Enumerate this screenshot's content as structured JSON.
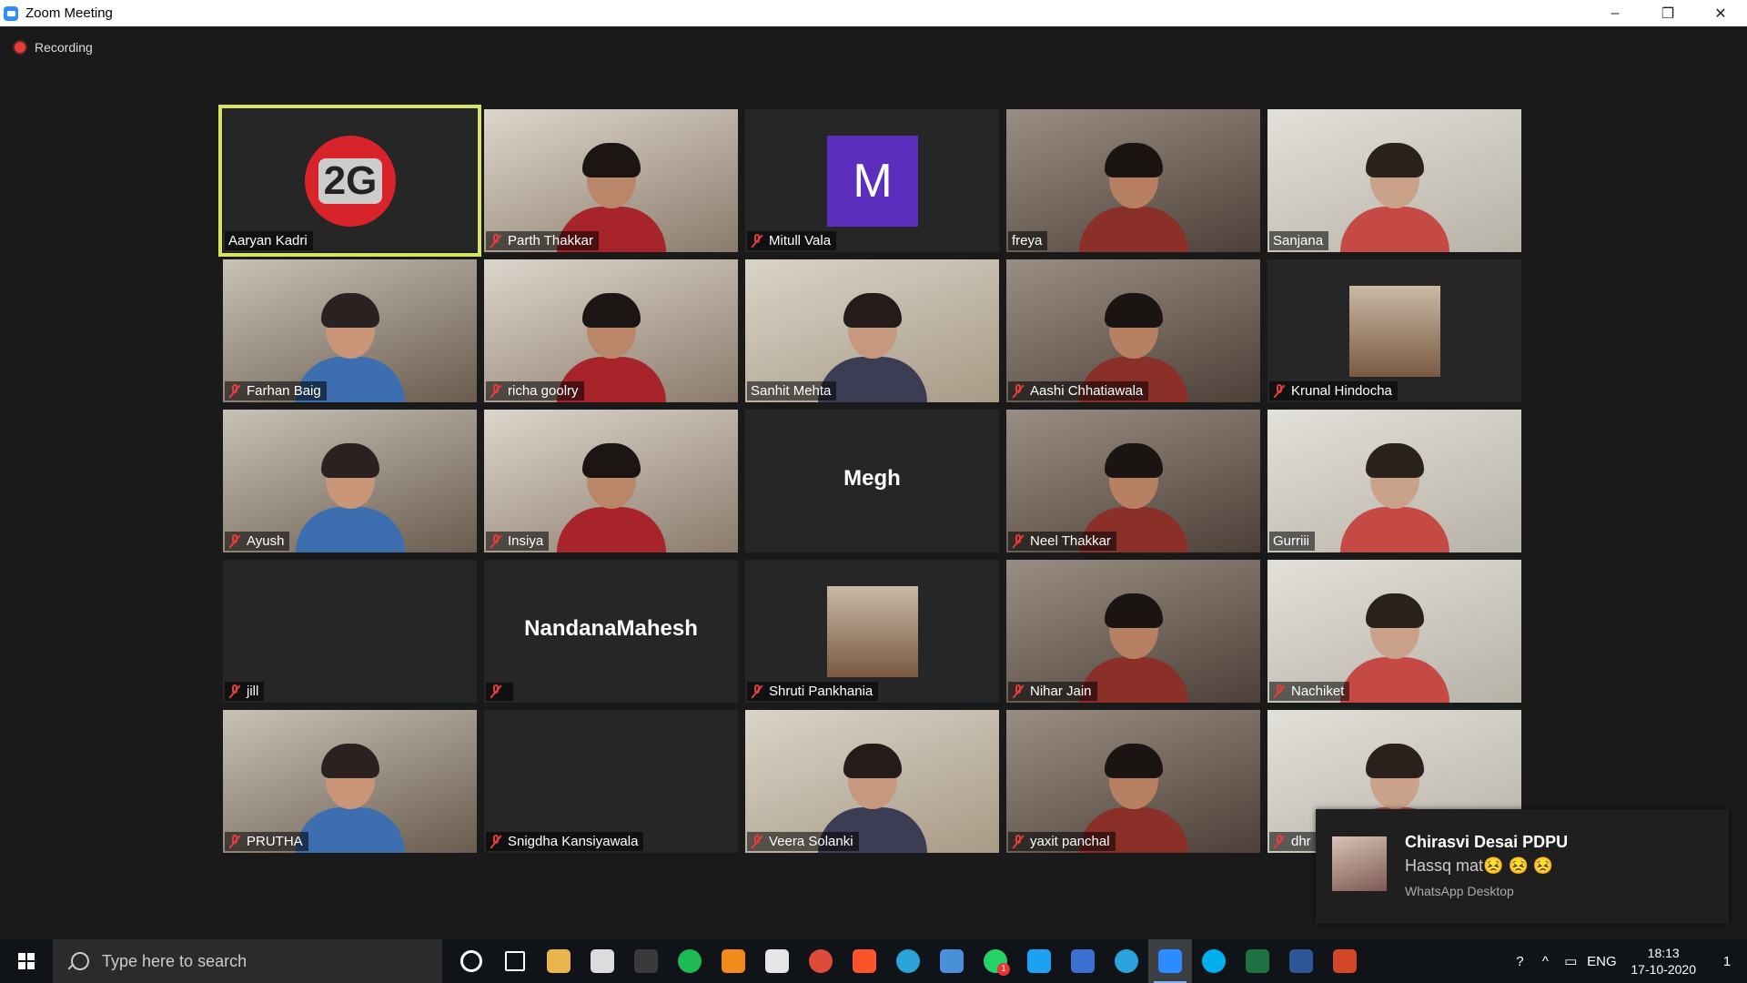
{
  "window": {
    "title": "Zoom Meeting",
    "controls": {
      "minimize": "–",
      "restore": "❐",
      "close": "✕"
    }
  },
  "recording": {
    "label": "Recording"
  },
  "participants": [
    {
      "name": "Aaryan Kadri",
      "muted": false,
      "kind": "logo",
      "logo_text": "2G",
      "active": true
    },
    {
      "name": "Parth Thakkar",
      "muted": true,
      "kind": "video"
    },
    {
      "name": "Mitull Vala",
      "muted": true,
      "kind": "initial",
      "initial": "M"
    },
    {
      "name": "freya",
      "muted": false,
      "kind": "video"
    },
    {
      "name": "Sanjana",
      "muted": false,
      "kind": "video"
    },
    {
      "name": "Farhan Baig",
      "muted": true,
      "kind": "video"
    },
    {
      "name": "richa goolry",
      "muted": true,
      "kind": "video"
    },
    {
      "name": "Sanhit Mehta",
      "muted": false,
      "kind": "video"
    },
    {
      "name": "Aashi Chhatiawala",
      "muted": true,
      "kind": "video"
    },
    {
      "name": "Krunal Hindocha",
      "muted": true,
      "kind": "photo"
    },
    {
      "name": "Ayush",
      "muted": true,
      "kind": "video"
    },
    {
      "name": "Insiya",
      "muted": true,
      "kind": "video"
    },
    {
      "name": "Megh",
      "muted": false,
      "kind": "bigname",
      "show_plate": false
    },
    {
      "name": "Neel Thakkar",
      "muted": true,
      "kind": "video"
    },
    {
      "name": "Gurriii",
      "muted": false,
      "kind": "video"
    },
    {
      "name": "jill",
      "muted": true,
      "kind": "blank"
    },
    {
      "name": "NandanaMahesh",
      "muted": true,
      "kind": "bigname",
      "plate_text": ""
    },
    {
      "name": "Shruti Pankhania",
      "muted": true,
      "kind": "photo"
    },
    {
      "name": "Nihar Jain",
      "muted": true,
      "kind": "video"
    },
    {
      "name": "Nachiket",
      "muted": true,
      "kind": "video"
    },
    {
      "name": "PRUTHA",
      "muted": true,
      "kind": "video"
    },
    {
      "name": "Snigdha Kansiyawala",
      "muted": true,
      "kind": "blank"
    },
    {
      "name": "Veera Solanki",
      "muted": true,
      "kind": "video"
    },
    {
      "name": "yaxit panchal",
      "muted": true,
      "kind": "video"
    },
    {
      "name": "dhr",
      "muted": true,
      "kind": "video"
    }
  ],
  "notification": {
    "sender": "Chirasvi Desai PDPU",
    "message": "Hassq mat😣 😣 😣",
    "app": "WhatsApp Desktop"
  },
  "taskbar": {
    "search_placeholder": "Type here to search",
    "apps": [
      {
        "name": "cortana",
        "color": "#101418"
      },
      {
        "name": "task-view",
        "color": "#101418"
      },
      {
        "name": "file-explorer",
        "color": "#e8b64a"
      },
      {
        "name": "store",
        "color": "#dcdcdc"
      },
      {
        "name": "app-dark",
        "color": "#3a3a3a"
      },
      {
        "name": "spotify",
        "color": "#1db954"
      },
      {
        "name": "vlc",
        "color": "#f28a1e"
      },
      {
        "name": "defender",
        "color": "#e6e6e6"
      },
      {
        "name": "chrome",
        "color": "#dd4b39"
      },
      {
        "name": "brave",
        "color": "#fb542b"
      },
      {
        "name": "edge",
        "color": "#2ba3d8"
      },
      {
        "name": "mail",
        "color": "#4a90d9"
      },
      {
        "name": "whatsapp",
        "color": "#25d366",
        "badge": "1"
      },
      {
        "name": "twitter",
        "color": "#1da1f2"
      },
      {
        "name": "instagram",
        "color": "#3b6fd1"
      },
      {
        "name": "telegram",
        "color": "#2aa3dd"
      },
      {
        "name": "zoom",
        "color": "#2d8cff",
        "active": true
      },
      {
        "name": "skype",
        "color": "#00aff0"
      },
      {
        "name": "excel",
        "color": "#1f7244"
      },
      {
        "name": "word",
        "color": "#2b5797"
      },
      {
        "name": "powerpoint",
        "color": "#d24726"
      }
    ],
    "tray": {
      "help": "?",
      "chevron": "^",
      "battery": "▭",
      "language": "ENG",
      "time": "18:13",
      "date": "17-10-2020",
      "notifications": "1"
    }
  }
}
